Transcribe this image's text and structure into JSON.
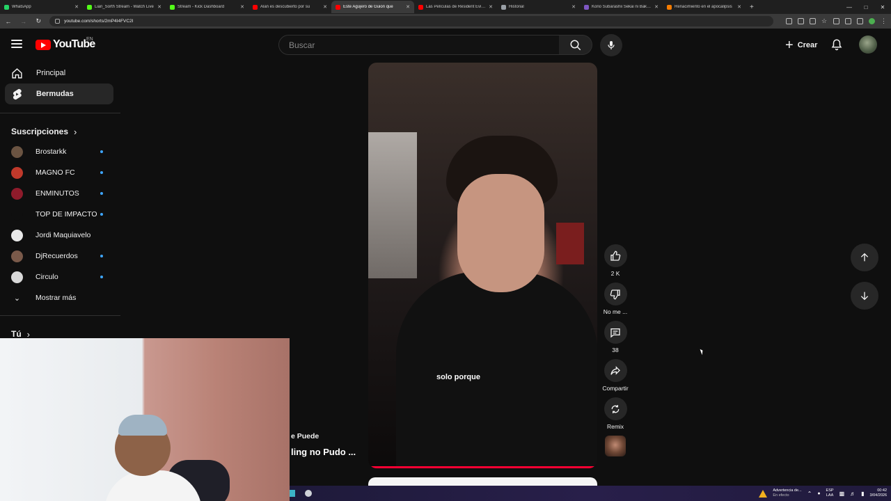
{
  "browser": {
    "tabs": [
      {
        "label": "WhatsApp",
        "color": "#25d366",
        "active": false
      },
      {
        "label": "Lian_Sorth Stream - Watch Live",
        "color": "#53fc18",
        "active": false
      },
      {
        "label": "Stream - Kick Dashboard",
        "color": "#53fc18",
        "active": false
      },
      {
        "label": "Alan es descubierto por su",
        "color": "#ff0000",
        "active": false
      },
      {
        "label": "Este Agujero de Guion que",
        "color": "#ff0000",
        "active": true
      },
      {
        "label": "Las Películas de Resident Evil N",
        "color": "#ff0000",
        "active": false
      },
      {
        "label": "Historial",
        "color": "#9aa0a6",
        "active": false
      },
      {
        "label": "Kono Subarashii Sekai ni Bakuen",
        "color": "#7e57c2",
        "active": false
      },
      {
        "label": "Renacimiento en el apocalipsis",
        "color": "#f57c00",
        "active": false
      }
    ],
    "new_tab": "+",
    "url": "youtube.com/shorts/2mP4I4FVC2I"
  },
  "header": {
    "logo_text": "YouTube",
    "country": "EN",
    "search_placeholder": "Buscar",
    "create_label": "Crear"
  },
  "sidebar": {
    "items": [
      {
        "label": "Principal",
        "icon": "home-icon"
      },
      {
        "label": "Bermudas",
        "icon": "shorts-icon"
      }
    ],
    "subscriptions_title": "Suscripciones",
    "subscriptions": [
      {
        "name": "Brostarkk",
        "color": "#6b5442",
        "new": true
      },
      {
        "name": "MAGNO FC",
        "color": "#c0392b",
        "new": true
      },
      {
        "name": "ENMINUTOS",
        "color": "#8e1b2b",
        "new": true
      },
      {
        "name": "TOP DE IMPACTO",
        "color": "#0f0f0f",
        "new": true
      },
      {
        "name": "Jordi Maquiavelo",
        "color": "#e8e8e8",
        "new": false
      },
      {
        "name": "DjRecuerdos",
        "color": "#7a5a4a",
        "new": true
      },
      {
        "name": "Circulo",
        "color": "#d8d8d8",
        "new": true
      }
    ],
    "show_more": "Mostrar más",
    "you_label": "Tú"
  },
  "video": {
    "caption": "solo porque",
    "title_fragment_1": "e Puede",
    "title_fragment_2": "ling no Pudo ..."
  },
  "actions": {
    "like_count": "2 K",
    "dislike_label": "No me ...",
    "comments_count": "38",
    "share_label": "Compartir",
    "remix_label": "Remix"
  },
  "taskbar": {
    "warning_line1": "Advertencia de...",
    "warning_line2": "En efecto",
    "lang_line1": "ESP",
    "lang_line2": "LAA",
    "time": "00:42",
    "date": "3/04/2026"
  }
}
